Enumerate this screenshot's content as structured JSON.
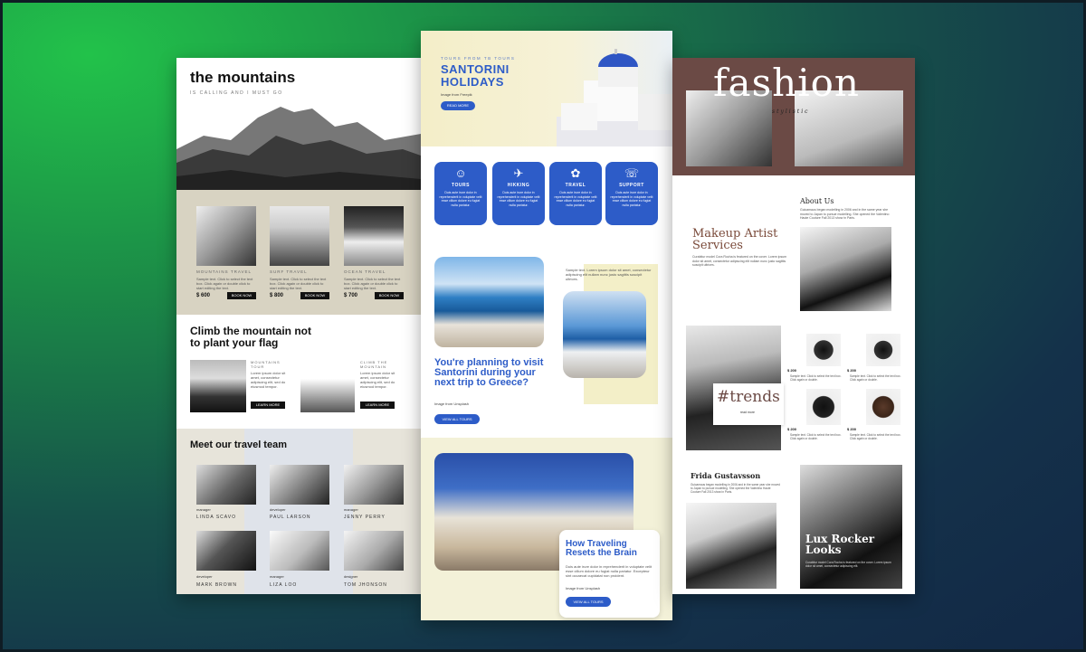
{
  "left": {
    "title": "the mountains",
    "subtitle": "IS CALLING AND I MUST GO",
    "tours": [
      {
        "label": "MOUNTAINS TRAVEL",
        "price": "$ 600",
        "btn": "BOOK NOW"
      },
      {
        "label": "SURF TRAVEL",
        "price": "$ 800",
        "btn": "BOOK NOW"
      },
      {
        "label": "OCEAN TRAVEL",
        "price": "$ 700",
        "btn": "BOOK NOW"
      }
    ],
    "tour_text": "Sample text. Click to select the text box. Click again or double click to start editing the text.",
    "heading2": "Climb the mountain not to plant your flag",
    "feat1_label": "MOUNTAINS TOUR",
    "feat2_label": "CLIMB THE MOUNTAIN",
    "feat_text": "Lorem ipsum dolor sit amet, consectetur adipiscing elit, sed do eiusmod tempor.",
    "learn_more": "LEARN MORE",
    "team_title": "Meet our travel team",
    "team": [
      {
        "role": "manager",
        "name": "LINDA SCAVO"
      },
      {
        "role": "developer",
        "name": "PAUL LARSON"
      },
      {
        "role": "manager",
        "name": "JENNY PERRY"
      },
      {
        "role": "developer",
        "name": "MARK BROWN"
      },
      {
        "role": "manager",
        "name": "LIZA LOO"
      },
      {
        "role": "designer",
        "name": "TOM JHONSON"
      }
    ]
  },
  "mid": {
    "kicker": "TOURS FROM TB TOURS",
    "title": "SANTORINI HOLIDAYS",
    "credit": "Image from Freepik",
    "read_more": "READ MORE",
    "cards": [
      {
        "icon": "☺",
        "title": "TOURS"
      },
      {
        "icon": "✈",
        "title": "HIKKING"
      },
      {
        "icon": "✿",
        "title": "TRAVEL"
      },
      {
        "icon": "☏",
        "title": "SUPPORT"
      }
    ],
    "card_text": "Duis aute irure dolor in reprehenderit in voluptate velit esse cillum dolore eu fugiat nulla pariatur.",
    "sample_text": "Sample text. Lorem ipsum dolor sit amet, consectetur adipiscing elit nullam nunc justo sagittis suscipit ultrices.",
    "plan_title": "You're planning to visit Santorini during your next trip to Greece?",
    "credit2": "Image from Unsplash",
    "view_tours": "VIEW ALL TOURS",
    "brain_title": "How Traveling Resets the Brain",
    "brain_text": "Duis aute irure dolor in reprehenderit in voluptate velit esse cillum dolore eu fugiat nulla pariatur. Excepteur sint occaecat cupidatat non proident.",
    "credit3": "Image from Unsplash",
    "view_tours2": "VIEW ALL TOURS"
  },
  "right": {
    "title": "fashion",
    "subtitle": "stylistic",
    "about": "About Us",
    "about_text": "Guicamaus began modelling in 2006 and in the same year she moved to Japan to pursue modelling. She opened the Valentino Haute Couture Fall 2013 show in Paris.",
    "makeup": "Makeup Artist Services",
    "makeup_text": "Curabitur model Cora Rocha is featured on the cover. Lorem ipsum dolor sit amet, consectetur adipiscing elit nullam nunc justo sagittis suscipit ultrices.",
    "trends": "#trends",
    "read_more": "read more",
    "price": "$ 200",
    "product_text": "Sample text. Click to select the text box. Click again or double.",
    "frida": "Frida Gustavsson",
    "frida_text": "Guicamaus began modelling in 2006 and in the same year she moved to Japan to pursue modelling. She opened the Valentino Haute Couture Fall 2013 show in Paris.",
    "lux": "Lux Rocker Looks",
    "lux_text": "Curabitur model Cora Rocha is featured on the cover. Lorem ipsum dolor sit amet, consectetur adipiscing elit."
  }
}
